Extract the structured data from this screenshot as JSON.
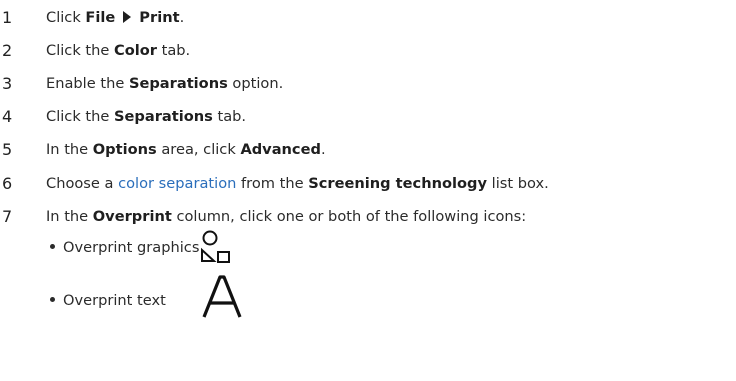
{
  "steps": [
    {
      "number": "1",
      "pre": "Click ",
      "b1": "File",
      "b2": "Print",
      "post": "."
    },
    {
      "number": "2",
      "pre": "Click the ",
      "b1": "Color",
      "post": " tab."
    },
    {
      "number": "3",
      "pre": "Enable the ",
      "b1": "Separations",
      "post": " option."
    },
    {
      "number": "4",
      "pre": "Click the ",
      "b1": "Separations",
      "post": " tab."
    },
    {
      "number": "5",
      "pre": "In the ",
      "b1": "Options",
      "mid": " area, click ",
      "b2": "Advanced",
      "post": "."
    },
    {
      "number": "6",
      "pre": "Choose a ",
      "link": "color separation",
      "mid": " from the ",
      "b1": "Screening technology",
      "post": " list box."
    },
    {
      "number": "7",
      "pre": "In the ",
      "b1": "Overprint",
      "post": " column, click one or both of the following icons:"
    }
  ],
  "bullets": [
    {
      "label": "Overprint graphics",
      "icon": "overprint-graphics-icon"
    },
    {
      "label": "Overprint text",
      "icon": "overprint-text-icon"
    }
  ],
  "colors": {
    "link": "#2a6ebb",
    "text": "#2b2b2b"
  }
}
